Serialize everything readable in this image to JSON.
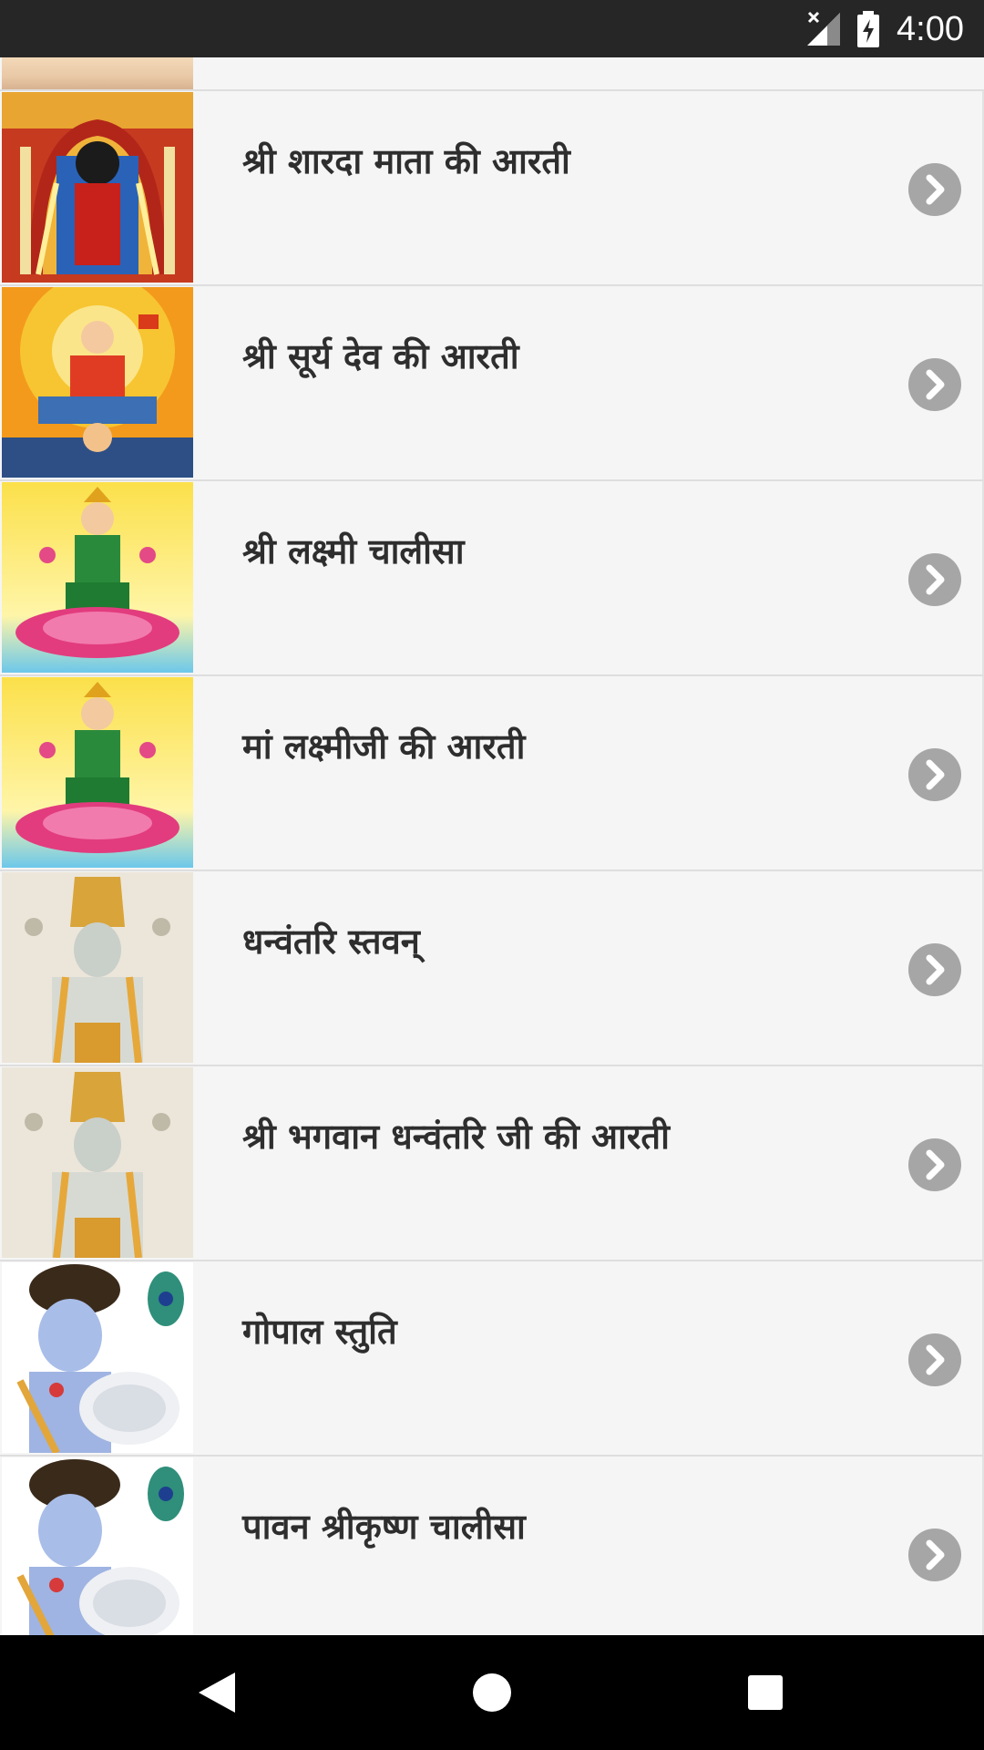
{
  "status_bar": {
    "time": "4:00",
    "signal_icon": "signal-no-connection-icon",
    "battery_icon": "battery-charging-icon"
  },
  "list": {
    "items": [
      {
        "title": "श्री शारदा माता की आरती",
        "thumb": "sharda-mata-image"
      },
      {
        "title": "श्री सूर्य देव की आरती",
        "thumb": "surya-dev-image"
      },
      {
        "title": "श्री लक्ष्मी चालीसा",
        "thumb": "lakshmi-image"
      },
      {
        "title": "मां लक्ष्मीजी की आरती",
        "thumb": "lakshmi-image"
      },
      {
        "title": "धन्वंतरि स्तवन्",
        "thumb": "dhanvantari-image"
      },
      {
        "title": "श्री भगवान धन्वंतरि जी की आरती",
        "thumb": "dhanvantari-image"
      },
      {
        "title": "गोपाल स्तुति",
        "thumb": "krishna-image"
      },
      {
        "title": "पावन श्रीकृष्ण चालीसा",
        "thumb": "krishna-image"
      }
    ],
    "chevron_icon": "chevron-right-circle-icon"
  },
  "nav_bar": {
    "back_icon": "back-triangle-icon",
    "home_icon": "home-circle-icon",
    "recent_icon": "recent-square-icon"
  },
  "colors": {
    "status_bar_bg": "#262626",
    "list_bg": "#f5f5f5",
    "divider": "#dedede",
    "title_text": "#2e2e2e",
    "chevron_bg": "#a6a6a6",
    "nav_bar_bg": "#000000"
  }
}
